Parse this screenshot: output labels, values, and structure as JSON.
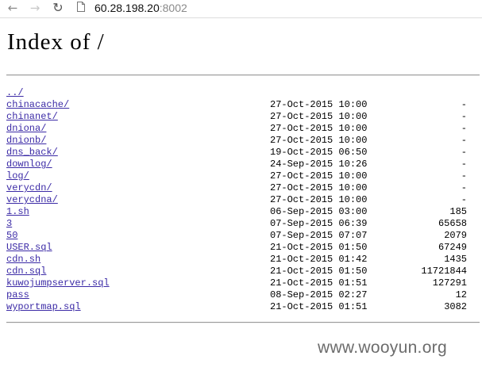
{
  "browser": {
    "url_host": "60.28.198.20",
    "url_port": ":8002",
    "icons": [
      "back-arrow-icon",
      "forward-arrow-icon",
      "reload-icon",
      "page-icon"
    ]
  },
  "page": {
    "title": "Index of /",
    "parent_link": "../",
    "entries": [
      {
        "name": "chinacache/",
        "date": "27-Oct-2015 10:00",
        "size": "-"
      },
      {
        "name": "chinanet/",
        "date": "27-Oct-2015 10:00",
        "size": "-"
      },
      {
        "name": "dniona/",
        "date": "27-Oct-2015 10:00",
        "size": "-"
      },
      {
        "name": "dnionb/",
        "date": "27-Oct-2015 10:00",
        "size": "-"
      },
      {
        "name": "dns_back/",
        "date": "19-Oct-2015 06:50",
        "size": "-"
      },
      {
        "name": "downlog/",
        "date": "24-Sep-2015 10:26",
        "size": "-"
      },
      {
        "name": "log/",
        "date": "27-Oct-2015 10:00",
        "size": "-"
      },
      {
        "name": "verycdn/",
        "date": "27-Oct-2015 10:00",
        "size": "-"
      },
      {
        "name": "verycdna/",
        "date": "27-Oct-2015 10:00",
        "size": "-"
      },
      {
        "name": "1.sh",
        "date": "06-Sep-2015 03:00",
        "size": "185"
      },
      {
        "name": "3",
        "date": "07-Sep-2015 06:39",
        "size": "65658"
      },
      {
        "name": "50",
        "date": "07-Sep-2015 07:07",
        "size": "2079"
      },
      {
        "name": "USER.sql",
        "date": "21-Oct-2015 01:50",
        "size": "67249"
      },
      {
        "name": "cdn.sh",
        "date": "21-Oct-2015 01:42",
        "size": "1435"
      },
      {
        "name": "cdn.sql",
        "date": "21-Oct-2015 01:50",
        "size": "11721844"
      },
      {
        "name": "kuwojumpserver.sql",
        "date": "21-Oct-2015 01:51",
        "size": "127291"
      },
      {
        "name": "pass",
        "date": "08-Sep-2015 02:27",
        "size": "12"
      },
      {
        "name": "wyportmap.sql",
        "date": "21-Oct-2015 01:51",
        "size": "3082"
      }
    ]
  },
  "watermark": "www.wooyun.org",
  "colors": {
    "link": "#3b2aa6",
    "rule": "#9a9a9a",
    "watermark": "#6c6c6c"
  }
}
